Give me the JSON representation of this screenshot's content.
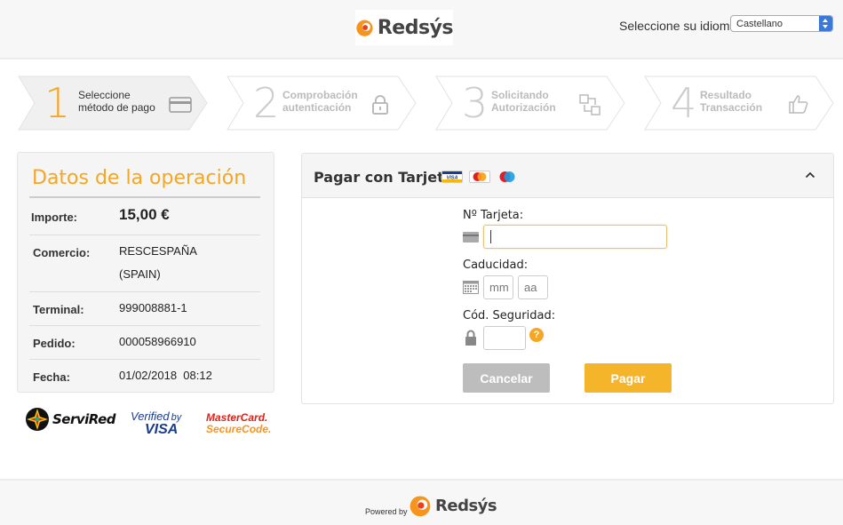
{
  "header": {
    "brand": "Redsýs",
    "language_label": "Seleccione su idioma",
    "language_selected": "Castellano"
  },
  "steps": [
    {
      "num": "1",
      "line1": "Seleccione",
      "line2": "método de pago",
      "icon": "card-icon",
      "state": "active"
    },
    {
      "num": "2",
      "line1": "Comprobación",
      "line2": "autenticación",
      "icon": "lock-icon",
      "state": "inactive"
    },
    {
      "num": "3",
      "line1": "Solicitando",
      "line2": "Autorización",
      "icon": "transfer-icon",
      "state": "inactive"
    },
    {
      "num": "4",
      "line1": "Resultado",
      "line2": "Transacción",
      "icon": "thumbs-up-icon",
      "state": "inactive"
    }
  ],
  "operation": {
    "title": "Datos de la operación",
    "rows": [
      {
        "key": "Importe:",
        "value": "15,00 €"
      },
      {
        "key": "Comercio:",
        "value": "RESCESPAÑA",
        "value2": "(SPAIN)"
      },
      {
        "key": "Terminal:",
        "value": "999008881-1"
      },
      {
        "key": "Pedido:",
        "value": "000058966910"
      },
      {
        "key": "Fecha:",
        "value": "01/02/2018  08:12"
      }
    ]
  },
  "brands": {
    "servired": "ServiRed",
    "verified_line1": "Verified",
    "verified_by": "by",
    "verified_line2": "VISA",
    "mc_line1": "MasterCard.",
    "mc_line2": "SecureCode."
  },
  "card_form": {
    "title": "Pagar con Tarjeta",
    "card_logo_visa": "VISA",
    "card_number_label": "Nº Tarjeta:",
    "card_number_value": "",
    "expiry_label": "Caducidad:",
    "expiry_month_placeholder": "mm",
    "expiry_year_placeholder": "aa",
    "cvv_label": "Cód. Seguridad:",
    "cvv_value": "",
    "help_glyph": "?",
    "cancel_label": "Cancelar",
    "pay_label": "Pagar"
  },
  "footer": {
    "powered_by": "Powered by",
    "brand": "Redsýs"
  },
  "colors": {
    "accent": "#f5a623",
    "pay_button": "#f5b52a",
    "cancel_button": "#bdbdbd"
  }
}
